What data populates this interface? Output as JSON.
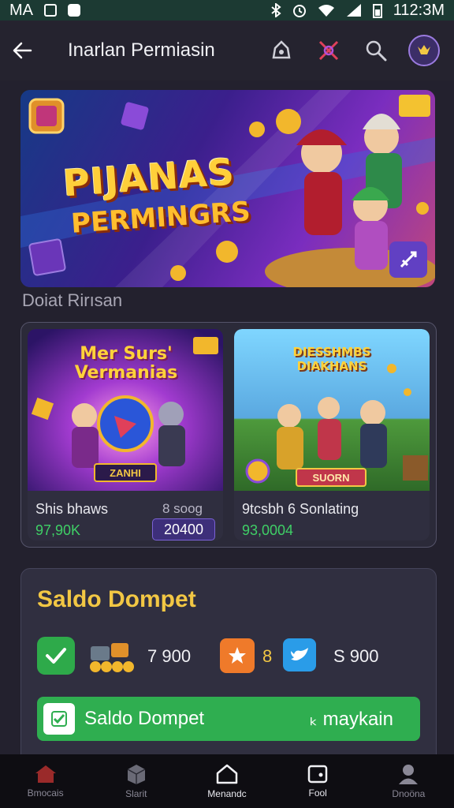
{
  "status": {
    "left_text": "MA",
    "time": "112:3M"
  },
  "header": {
    "title": "Inarlan Permiasin"
  },
  "hero": {
    "title1": "PIJANAS",
    "title2": "PERMINGRS",
    "badge": ""
  },
  "section": {
    "title": "Doiat Rirısan"
  },
  "cards": [
    {
      "art_title": "Mer Surs'\nVermanias",
      "banner": "ZANHI",
      "name": "Shis bhaws",
      "count": "8 soog",
      "price": "97,90K",
      "button": "20400"
    },
    {
      "art_title": "DIESSHMBS\nDIAKHANS",
      "banner": "SUORN",
      "name": "9tcsbh 6 Sonlating",
      "count": "",
      "price": "93,0004",
      "button": ""
    }
  ],
  "wallet": {
    "title": "Saldo Dompet",
    "value1": "7 900",
    "mark": "8",
    "value2": "S 900",
    "button_label": "Saldo Dompet",
    "button_right": "ₖ maykain"
  },
  "nav": [
    {
      "label": "Bmocais",
      "icon": "home-icon"
    },
    {
      "label": "Slarit",
      "icon": "box-icon"
    },
    {
      "label": "Menandc",
      "icon": "house-outline-icon"
    },
    {
      "label": "Fool",
      "icon": "wallet-icon"
    },
    {
      "label": "Dnoöna",
      "icon": "profile-icon"
    }
  ],
  "colors": {
    "accent": "#2fae50",
    "gold": "#f2c744",
    "purple": "#6140c3",
    "background": "#23212e"
  }
}
